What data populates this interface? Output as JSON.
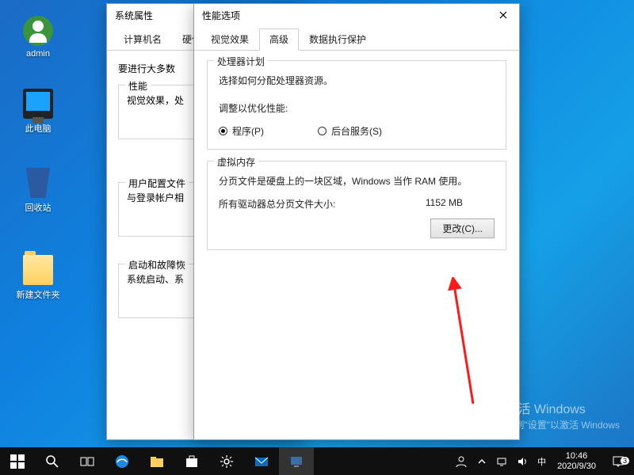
{
  "desktop": {
    "icons": [
      {
        "name": "admin",
        "label": "admin"
      },
      {
        "name": "this-pc",
        "label": "此电脑"
      },
      {
        "name": "recycle-bin",
        "label": "回收站"
      },
      {
        "name": "new-folder",
        "label": "新建文件夹"
      }
    ]
  },
  "back_dialog": {
    "title": "系统属性",
    "tabs": [
      "计算机名",
      "硬件"
    ],
    "instruction": "要进行大多数",
    "groups": {
      "perf": {
        "legend": "性能",
        "line": "视觉效果，处"
      },
      "profile": {
        "legend": "用户配置文件",
        "line": "与登录帐户相"
      },
      "startup": {
        "legend": "启动和故障恢",
        "line": "系统启动、系"
      }
    }
  },
  "front_dialog": {
    "title": "性能选项",
    "tabs": [
      "视觉效果",
      "高级",
      "数据执行保护"
    ],
    "active_tab": 1,
    "cpu": {
      "legend": "处理器计划",
      "desc": "选择如何分配处理器资源。",
      "optimize": "调整以优化性能:",
      "program": "程序(P)",
      "background": "后台服务(S)"
    },
    "vm": {
      "legend": "虚拟内存",
      "desc": "分页文件是硬盘上的一块区域，Windows 当作 RAM 使用。",
      "size_label": "所有驱动器总分页文件大小:",
      "size_value": "1152 MB",
      "change": "更改(C)..."
    }
  },
  "watermark": {
    "title": "激活 Windows",
    "sub": "转到\"设置\"以激活 Windows"
  },
  "taskbar": {
    "time": "10:46",
    "date": "2020/9/30",
    "ime": "中",
    "notif_count": "3"
  }
}
